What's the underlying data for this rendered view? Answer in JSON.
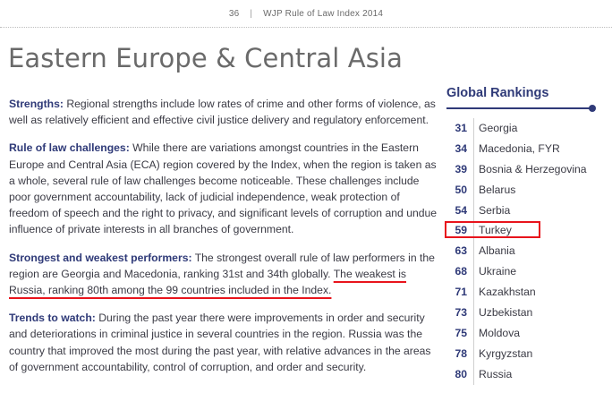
{
  "header": {
    "page_number": "36",
    "separator": "|",
    "publication": "WJP Rule of Law Index 2014"
  },
  "title": "Eastern Europe & Central Asia",
  "sections": {
    "strengths": {
      "lead": "Strengths:",
      "text": " Regional strengths include low rates of crime and other forms of violence, as well as relatively efficient and effective civil justice delivery and regulatory enforcement."
    },
    "challenges": {
      "lead": "Rule of law challenges:",
      "text": " While there are variations amongst countries in the Eastern Europe and Central Asia (ECA) region covered by the Index, when the region is taken as a whole, several rule of law challenges become noticeable. These challenges include poor government accountability, lack of judicial independence, weak protection of freedom of speech and the right to privacy, and significant levels of corruption and undue influence of private interests in all branches of government."
    },
    "performers": {
      "lead": "Strongest and weakest performers:",
      "text": " The strongest overall rule of law performers in the region are Georgia and Macedonia, ranking 31st and 34th globally. ",
      "underlined": "The weakest is Russia, ranking 80th among the 99 countries included in the Index."
    },
    "trends": {
      "lead": "Trends to watch:",
      "text": " During the past year there were improvements in order and security and deteriorations in criminal justice in several countries in the region. Russia was the country that improved the most during the past year, with relative advances in the areas of government accountability, control of corruption, and order and security."
    }
  },
  "rankings": {
    "title": "Global Rankings",
    "accent_color": "#2f3a78",
    "highlight_color": "#e8141c",
    "items": [
      {
        "rank": "31",
        "country": "Georgia"
      },
      {
        "rank": "34",
        "country": "Macedonia, FYR"
      },
      {
        "rank": "39",
        "country": "Bosnia & Herzegovina"
      },
      {
        "rank": "50",
        "country": "Belarus"
      },
      {
        "rank": "54",
        "country": "Serbia"
      },
      {
        "rank": "59",
        "country": "Turkey"
      },
      {
        "rank": "63",
        "country": "Albania"
      },
      {
        "rank": "68",
        "country": "Ukraine"
      },
      {
        "rank": "71",
        "country": "Kazakhstan"
      },
      {
        "rank": "73",
        "country": "Uzbekistan"
      },
      {
        "rank": "75",
        "country": "Moldova"
      },
      {
        "rank": "78",
        "country": "Kyrgyzstan"
      },
      {
        "rank": "80",
        "country": "Russia"
      }
    ]
  }
}
